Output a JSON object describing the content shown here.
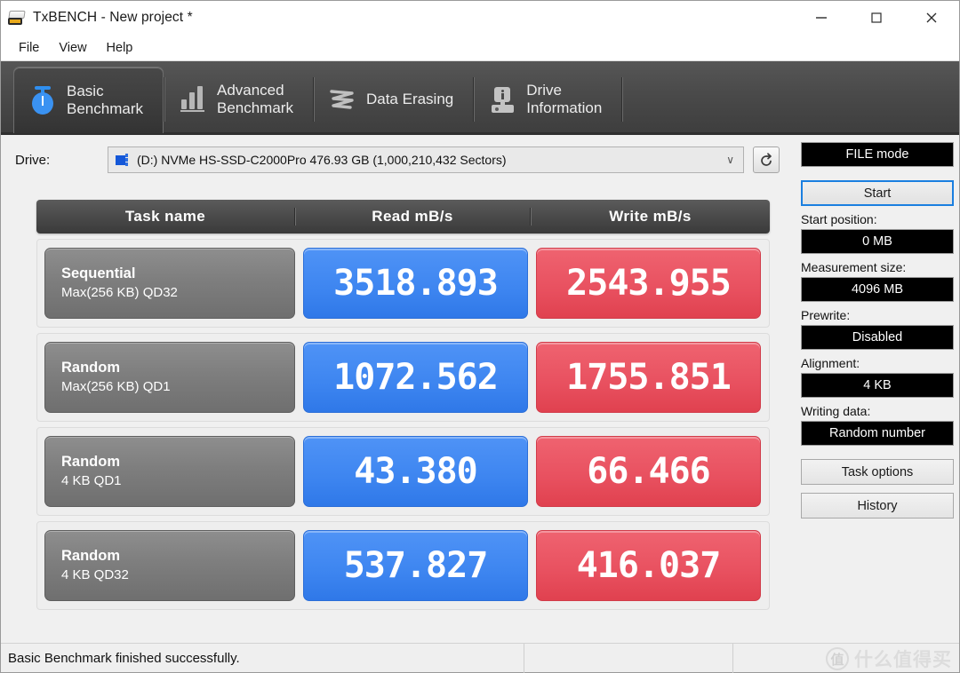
{
  "window": {
    "title": "TxBENCH - New project *",
    "icon": "drive-app-icon",
    "controls": {
      "minimize": "minimize-icon",
      "maximize": "maximize-icon",
      "close": "close-icon"
    }
  },
  "menubar": {
    "items": [
      {
        "label": "File"
      },
      {
        "label": "View"
      },
      {
        "label": "Help"
      }
    ]
  },
  "tabs": [
    {
      "label_line1": "Basic",
      "label_line2": "Benchmark",
      "icon": "stopwatch-icon",
      "active": true
    },
    {
      "label_line1": "Advanced",
      "label_line2": "Benchmark",
      "icon": "bar-chart-icon",
      "active": false
    },
    {
      "label_line1": "Data Erasing",
      "label_line2": "",
      "icon": "zigzag-erase-icon",
      "active": false
    },
    {
      "label_line1": "Drive",
      "label_line2": "Information",
      "icon": "drive-info-icon",
      "active": false
    }
  ],
  "drive": {
    "label": "Drive:",
    "selected": "(D:) NVMe HS-SSD-C2000Pro  476.93 GB (1,000,210,432 Sectors)",
    "caret": "∨",
    "refresh_icon": "refresh-icon",
    "disk_icon": "disk-icon"
  },
  "table": {
    "headers": [
      "Task name",
      "Read mB/s",
      "Write mB/s"
    ],
    "rows": [
      {
        "task_line1": "Sequential",
        "task_line2": "Max(256 KB) QD32",
        "read": "3518.893",
        "write": "2543.955"
      },
      {
        "task_line1": "Random",
        "task_line2": "Max(256 KB) QD1",
        "read": "1072.562",
        "write": "1755.851"
      },
      {
        "task_line1": "Random",
        "task_line2": "4 KB QD1",
        "read": "43.380",
        "write": "66.466"
      },
      {
        "task_line1": "Random",
        "task_line2": "4 KB QD32",
        "read": "537.827",
        "write": "416.037"
      }
    ]
  },
  "sidebar": {
    "mode": "FILE mode",
    "start_button": "Start",
    "start_position_label": "Start position:",
    "start_position_value": "0 MB",
    "measurement_size_label": "Measurement size:",
    "measurement_size_value": "4096 MB",
    "prewrite_label": "Prewrite:",
    "prewrite_value": "Disabled",
    "alignment_label": "Alignment:",
    "alignment_value": "4 KB",
    "writing_data_label": "Writing data:",
    "writing_data_value": "Random number",
    "task_options_button": "Task options",
    "history_button": "History"
  },
  "statusbar": {
    "message": "Basic Benchmark finished successfully.",
    "panel2": "",
    "panel3": ""
  },
  "watermark": {
    "mark": "值",
    "text": "什么值得买"
  },
  "colors": {
    "read_blue": "#3d85f0",
    "write_red": "#e8505f",
    "tab_bar": "#4a4a4a",
    "header_gray": "#4a4a4a",
    "accent_focus": "#1a7fe0"
  }
}
